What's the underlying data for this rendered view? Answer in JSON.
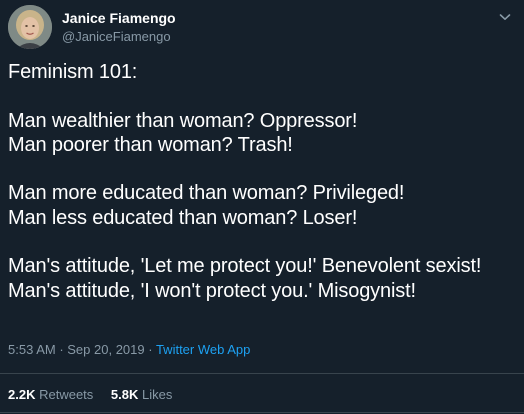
{
  "author": {
    "display_name": "Janice Fiamengo",
    "handle": "@JaniceFiamengo"
  },
  "tweet": {
    "lines": [
      "Feminism 101:",
      "",
      "Man wealthier than woman? Oppressor!",
      "Man poorer than woman? Trash!",
      "",
      "Man more educated than woman? Privileged!",
      "Man less educated than woman? Loser!",
      "",
      "Man's attitude, 'Let me protect you!' Benevolent sexist!",
      "Man's attitude, 'I won't protect you.' Misogynist!"
    ]
  },
  "meta": {
    "time": "5:53 AM",
    "separator": " · ",
    "date": "Sep 20, 2019",
    "separator2": " · ",
    "app": "Twitter Web App"
  },
  "stats": {
    "retweets_count": "2.2K",
    "retweets_label": "Retweets",
    "likes_count": "5.8K",
    "likes_label": "Likes"
  },
  "icons": {
    "caret": "chevron-down-icon"
  },
  "colors": {
    "background": "#15202b",
    "secondary_text": "#8899a6",
    "link": "#1da1f2",
    "divider": "#38444d"
  }
}
